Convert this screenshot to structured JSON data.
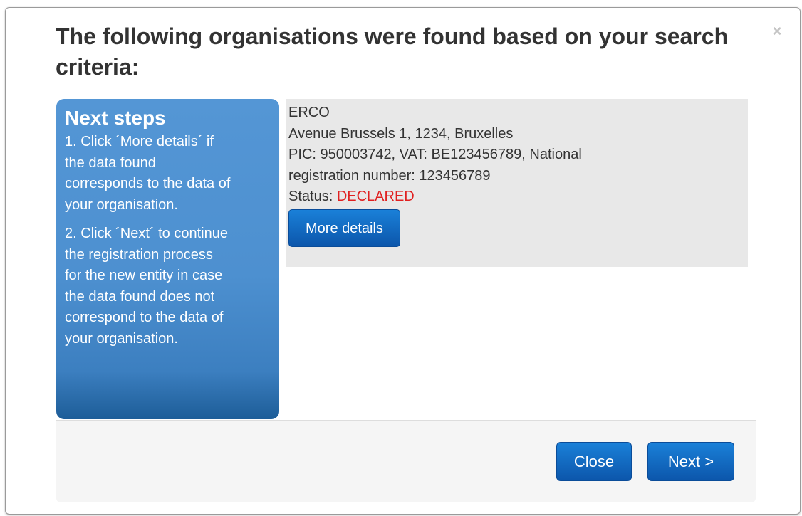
{
  "dialog": {
    "title": "The following organisations were found based on your search criteria:",
    "close_symbol": "×"
  },
  "next_steps": {
    "heading": "Next steps",
    "step1_lines": [
      "1. Click ´More details´ if",
      "the data found",
      "corresponds to the data of",
      "your organisation."
    ],
    "step2_lines": [
      "2. Click ´Next´ to continue",
      "the registration process",
      "for the new entity in case",
      "the data found does not",
      "correspond to the data of",
      "your organisation."
    ]
  },
  "result": {
    "name": "ERCO",
    "address": "Avenue Brussels 1, 1234, Bruxelles",
    "ids_line1": "PIC: 950003742, VAT: BE123456789, National",
    "ids_line2": "registration number: 123456789",
    "status_label": "Status: ",
    "status_value": "DECLARED",
    "more_details_label": "More details"
  },
  "footer": {
    "close_label": "Close",
    "next_label": "Next >"
  },
  "colors": {
    "panel_blue": "#4d90d0",
    "button_blue": "#0c56ab",
    "status_red": "#e02020",
    "result_bg": "#e8e8e8"
  }
}
